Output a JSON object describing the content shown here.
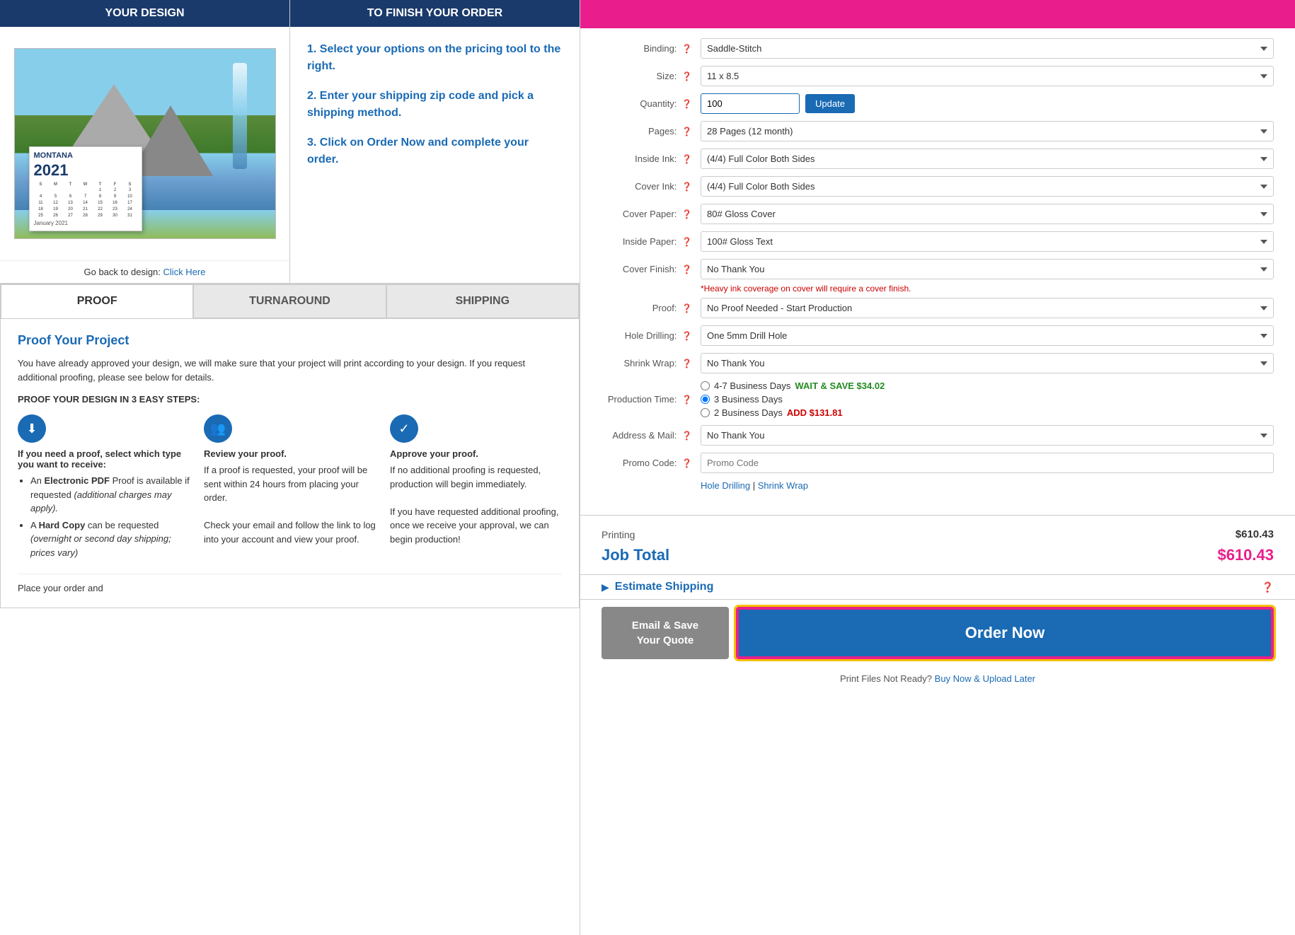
{
  "left": {
    "your_design": {
      "header": "YOUR DESIGN",
      "go_back_text": "Go back to design:",
      "go_back_link": "Click Here"
    },
    "finish_order": {
      "header": "TO FINISH YOUR ORDER",
      "steps": [
        "1. Select your options on the pricing tool to the right.",
        "2. Enter your shipping zip code and pick a shipping method.",
        "3. Click on Order Now and complete your order."
      ]
    },
    "tabs": [
      "PROOF",
      "TURNAROUND",
      "SHIPPING"
    ],
    "active_tab": "PROOF",
    "proof": {
      "title": "Proof Your Project",
      "description": "You have already approved your design, we will make sure that your project will print according to your design. If you request additional proofing, please see below for details.",
      "steps_title": "PROOF YOUR DESIGN IN 3 EASY STEPS:",
      "step1_title": "If you need a proof, select which type you want to receive:",
      "step1_body_intro": "An Electronic PDF Proof is available if requested (additional charges may apply).",
      "step1_body2": "A Hard Copy can be requested (overnight or second day shipping; prices vary)",
      "step2_title": "Review your proof.",
      "step2_body": "If a proof is requested, your proof will be sent within 24 hours from placing your order.\n\nCheck your email and follow the link to log into your account and view your proof.",
      "step3_title": "Approve your proof.",
      "step3_body": "If no additional proofing is requested, production will begin immediately.\n\nIf you have requested additional proofing, once we receive your approval, we can begin production!",
      "bottom_text": "Place your order and"
    }
  },
  "right": {
    "top_bar_color": "#e91e8c",
    "fields": {
      "binding_label": "Binding:",
      "binding_value": "Saddle-Stitch",
      "size_label": "Size:",
      "size_value": "11 x 8.5",
      "quantity_label": "Quantity:",
      "quantity_value": "100",
      "update_label": "Update",
      "pages_label": "Pages:",
      "pages_value": "28 Pages (12 month)",
      "inside_ink_label": "Inside Ink:",
      "inside_ink_value": "(4/4) Full Color Both Sides",
      "cover_ink_label": "Cover Ink:",
      "cover_ink_value": "(4/4) Full Color Both Sides",
      "cover_paper_label": "Cover Paper:",
      "cover_paper_value": "80# Gloss Cover",
      "inside_paper_label": "Inside Paper:",
      "inside_paper_value": "100# Gloss Text",
      "cover_finish_label": "Cover Finish:",
      "cover_finish_value": "No Thank You",
      "cover_finish_warning": "*Heavy ink coverage on cover will require a cover finish.",
      "proof_label": "Proof:",
      "proof_value": "No Proof Needed - Start Production",
      "hole_drilling_label": "Hole Drilling:",
      "hole_drilling_value": "One 5mm Drill Hole",
      "shrink_wrap_label": "Shrink Wrap:",
      "shrink_wrap_value": "No Thank You",
      "production_time_label": "Production Time:",
      "prod_option1": "4-7 Business Days",
      "prod_save": "WAIT & SAVE $34.02",
      "prod_option2": "3 Business Days",
      "prod_option3": "2 Business Days",
      "prod_add": "ADD $131.81",
      "address_mail_label": "Address & Mail:",
      "address_mail_value": "No Thank You",
      "promo_code_label": "Promo Code:",
      "promo_placeholder": "Promo Code",
      "hole_drilling_link": "Hole Drilling",
      "shrink_wrap_link": "Shrink Wrap",
      "printing_label": "Printing",
      "printing_value": "$610.43",
      "job_total_label": "Job Total",
      "job_total_value": "$610.43",
      "estimate_shipping": "Estimate Shipping",
      "email_save_btn": "Email & Save\nYour Quote",
      "order_now_btn": "Order Now",
      "print_files_text": "Print Files Not Ready?",
      "buy_upload_link": "Buy Now & Upload Later"
    }
  }
}
